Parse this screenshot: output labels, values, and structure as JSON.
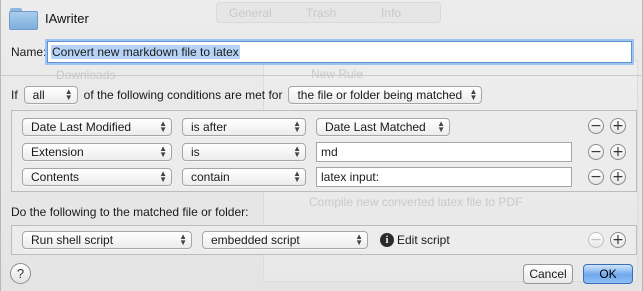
{
  "window": {
    "title": "IAwriter"
  },
  "background": {
    "tabs": [
      "General",
      "Trash",
      "Info"
    ],
    "items": [
      "Downloads",
      "New Rule",
      "Compile new converted latex file to PDF"
    ]
  },
  "name": {
    "label": "Name:",
    "value": "Convert new markdown file to latex"
  },
  "conditions_header": {
    "if_label": "If",
    "quantifier": "all",
    "middle_text": "of the following conditions are met for",
    "target": "the file or folder being matched"
  },
  "conditions": [
    {
      "attribute": "Date Last Modified",
      "operator": "is after",
      "value": "Date Last Matched",
      "value_type": "popup"
    },
    {
      "attribute": "Extension",
      "operator": "is",
      "value": "md",
      "value_type": "text"
    },
    {
      "attribute": "Contents",
      "operator": "contain",
      "value": "latex input:",
      "value_type": "text"
    }
  ],
  "actions_label": "Do the following to the matched file or folder:",
  "action": {
    "type": "Run shell script",
    "script_source": "embedded script",
    "edit_label": "Edit script"
  },
  "buttons": {
    "help": "?",
    "cancel": "Cancel",
    "ok": "OK",
    "remove": "−",
    "add": "+"
  },
  "icons": {
    "folder": "folder-icon",
    "info": "info-icon"
  },
  "colors": {
    "accent": "#5c93d6",
    "selection": "#b5d3f7"
  }
}
